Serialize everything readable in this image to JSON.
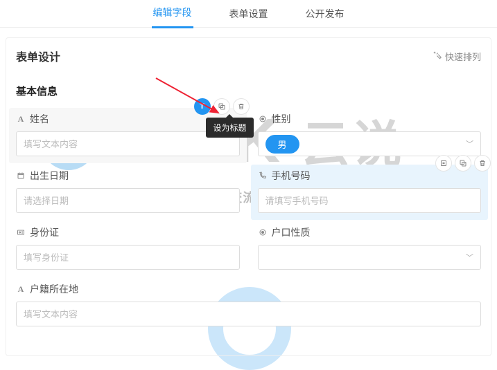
{
  "tabs": {
    "edit": "编辑字段",
    "settings": "表单设置",
    "publish": "公开发布"
  },
  "card": {
    "title": "表单设计",
    "quick_sort": "快速排列",
    "section": "基本信息"
  },
  "actions": {
    "set_title_tooltip": "设为标题",
    "set_title_icon": "T",
    "copy_icon_title": "复制",
    "delete_icon_title": "删除",
    "edit_icon_title": "编辑"
  },
  "fields": {
    "name": {
      "label": "姓名",
      "placeholder": "填写文本内容"
    },
    "gender": {
      "label": "性别",
      "value": "男"
    },
    "birth": {
      "label": "出生日期",
      "placeholder": "请选择日期"
    },
    "phone": {
      "label": "手机号码",
      "placeholder": "请填写手机号码"
    },
    "idcard": {
      "label": "身份证",
      "placeholder": "填写身份证"
    },
    "hukou": {
      "label": "户口性质",
      "value": ""
    },
    "address": {
      "label": "户籍所在地",
      "placeholder": "填写文本内容"
    }
  },
  "watermark": {
    "line1_latin": "TALK",
    "line1_cn": "云说",
    "line2": "-www.idctalk.com-国内专业云计算交流服务平台-"
  }
}
